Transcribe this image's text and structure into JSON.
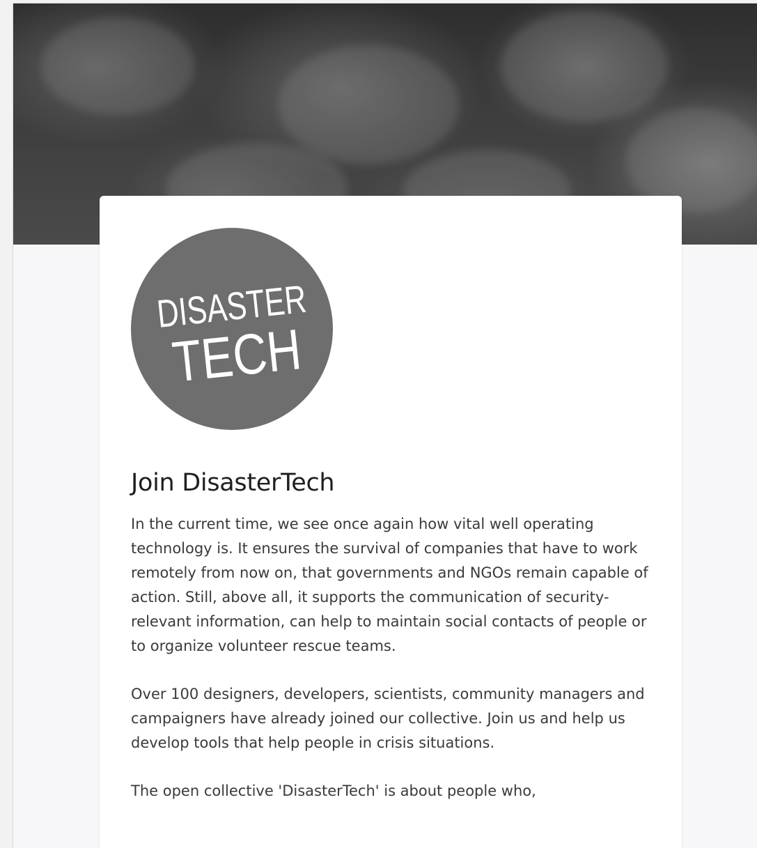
{
  "logo": {
    "line1": "DISASTER",
    "line2": "TECH",
    "color": "#6e6e6e"
  },
  "title": "Join DisasterTech",
  "paragraphs": [
    "In the current time, we see once again how vital well operating technology is. It ensures the survival of companies that have to work remotely from now on, that governments and NGOs remain capable of action. Still, above all, it supports the communication of security-relevant information, can help to maintain social contacts  of people or to organize volunteer rescue teams.",
    "Over 100 designers, developers, scientists, community managers and campaigners have already joined our collective. Join us and help us develop tools that help people in crisis situations.",
    "The open collective 'DisasterTech' is about people who,"
  ]
}
